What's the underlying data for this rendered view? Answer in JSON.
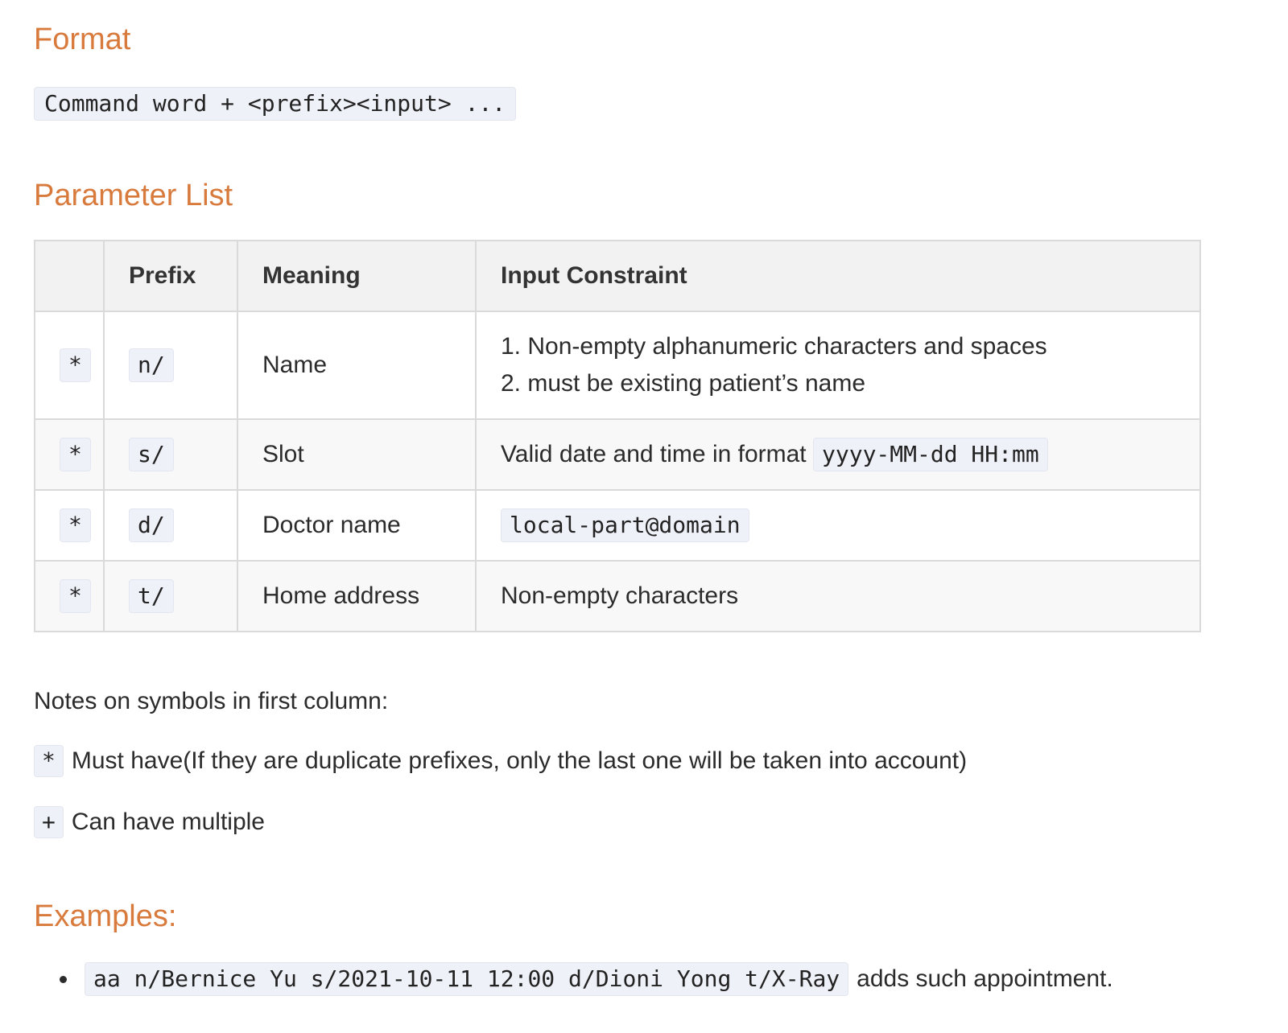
{
  "format": {
    "heading": "Format",
    "code": "Command word + <prefix><input> ..."
  },
  "parameters": {
    "heading": "Parameter List",
    "columns": [
      "",
      "Prefix",
      "Meaning",
      "Input Constraint"
    ],
    "rows": [
      {
        "symbol": "*",
        "prefix": "n/",
        "meaning": "Name",
        "constraint_lines": [
          "1. Non-empty alphanumeric characters and spaces",
          "2. must be existing patient’s name"
        ]
      },
      {
        "symbol": "*",
        "prefix": "s/",
        "meaning": "Slot",
        "constraint_text": "Valid date and time in format",
        "constraint_code": "yyyy-MM-dd HH:mm"
      },
      {
        "symbol": "*",
        "prefix": "d/",
        "meaning": "Doctor name",
        "constraint_code": "local-part@domain"
      },
      {
        "symbol": "*",
        "prefix": "t/",
        "meaning": "Home address",
        "constraint_text": "Non-empty characters"
      }
    ]
  },
  "notes": {
    "title": "Notes on symbols in first column:",
    "items": [
      {
        "symbol": "*",
        "text": "Must have(If they are duplicate prefixes, only the last one will be taken into account)"
      },
      {
        "symbol": "+",
        "text": "Can have multiple"
      }
    ]
  },
  "examples": {
    "heading": "Examples:",
    "items": [
      {
        "code": "aa n/Bernice Yu s/2021-10-11 12:00 d/Dioni Yong t/X-Ray",
        "text": "adds such appointment."
      }
    ]
  }
}
